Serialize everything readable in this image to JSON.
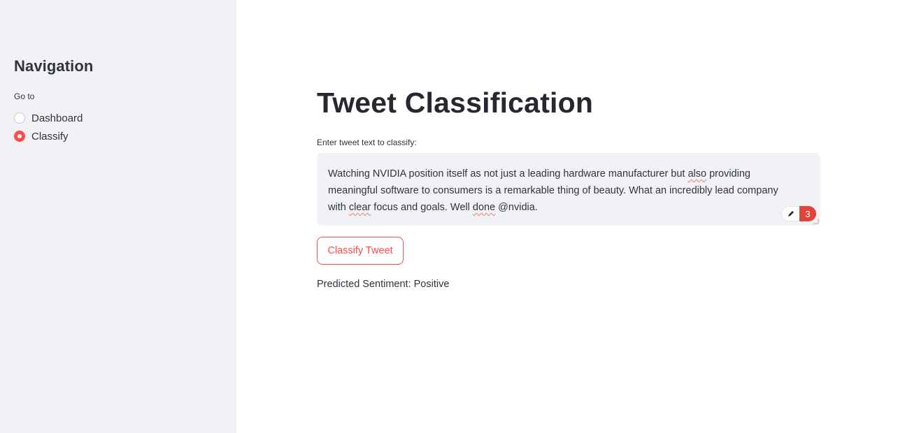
{
  "sidebar": {
    "title": "Navigation",
    "radio_label": "Go to",
    "options": [
      {
        "label": "Dashboard",
        "selected": false
      },
      {
        "label": "Classify",
        "selected": true
      }
    ]
  },
  "main": {
    "title": "Tweet Classification",
    "input_label": "Enter tweet text to classify:",
    "tweet": {
      "line1_a": "Watching NVIDIA position itself as not just a leading hardware manufacturer but ",
      "line1_b": "also",
      "line1_c": " providing",
      "line2": "meaningful software to consumers is a remarkable thing of beauty. What an incredibly lead company",
      "line3_a": "with ",
      "line3_b": "clear",
      "line3_c": " focus and goals. Well ",
      "line3_d": "done",
      "line3_e": " @nvidia."
    },
    "grammar_count": "3",
    "button_label": "Classify Tweet",
    "result_text": "Predicted Sentiment: Positive"
  },
  "colors": {
    "accent": "#ff4b4b",
    "sidebar_bg": "#f0f2f6",
    "text": "#31333f"
  },
  "icons": {
    "grammar_pen": "pen-icon"
  }
}
